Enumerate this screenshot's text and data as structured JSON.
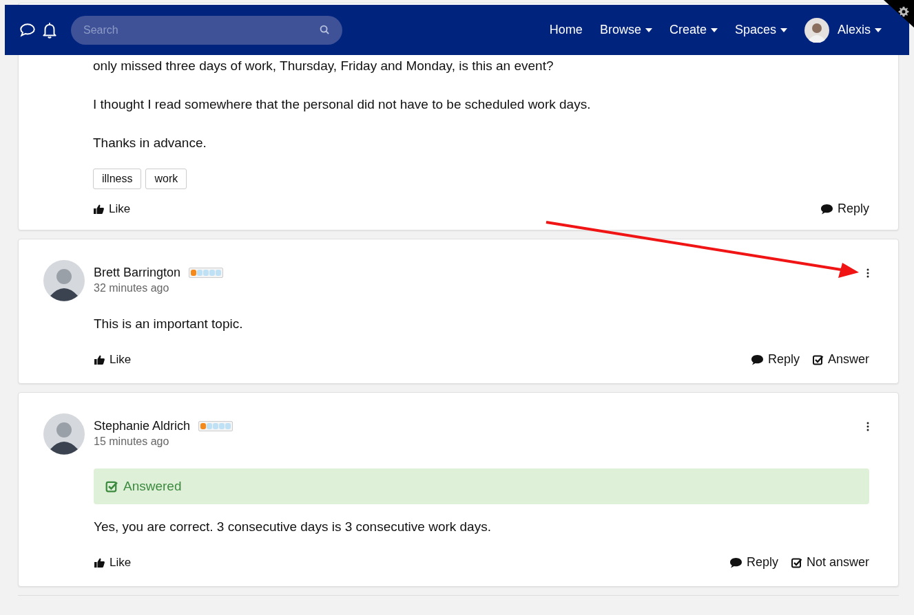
{
  "header": {
    "search": {
      "placeholder": "Search"
    },
    "nav": [
      {
        "label": "Home",
        "dropdown": false
      },
      {
        "label": "Browse",
        "dropdown": true
      },
      {
        "label": "Create",
        "dropdown": true
      },
      {
        "label": "Spaces",
        "dropdown": true
      }
    ],
    "user": {
      "name": "Alexis"
    }
  },
  "posts": [
    {
      "kind": "question",
      "paragraphs": [
        "only missed three days of work, Thursday, Friday and Monday, is this an event?",
        "I thought I read somewhere that the personal did not have to be scheduled work days.",
        "Thanks in advance."
      ],
      "tags": [
        "illness",
        "work"
      ],
      "actions": [
        {
          "kind": "like",
          "label": "Like"
        },
        {
          "kind": "reply",
          "label": "Reply"
        }
      ]
    },
    {
      "kind": "reply",
      "author": "Brett Barrington",
      "rank": {
        "level": 0.2
      },
      "time": "32 minutes ago",
      "menu": true,
      "paragraphs": [
        "This is an important topic."
      ],
      "actions": [
        {
          "kind": "like",
          "label": "Like"
        },
        {
          "kind": "reply",
          "label": "Reply"
        },
        {
          "kind": "check",
          "label": "Answer"
        }
      ]
    },
    {
      "kind": "reply",
      "author": "Stephanie Aldrich",
      "rank": {
        "level": 0.2
      },
      "time": "15 minutes ago",
      "menu": true,
      "answered": "Answered",
      "paragraphs": [
        "Yes, you are correct. 3 consecutive days is 3 consecutive work days."
      ],
      "actions": [
        {
          "kind": "like",
          "label": "Like"
        },
        {
          "kind": "reply",
          "label": "Reply"
        },
        {
          "kind": "check",
          "label": "Not answer"
        }
      ]
    }
  ]
}
